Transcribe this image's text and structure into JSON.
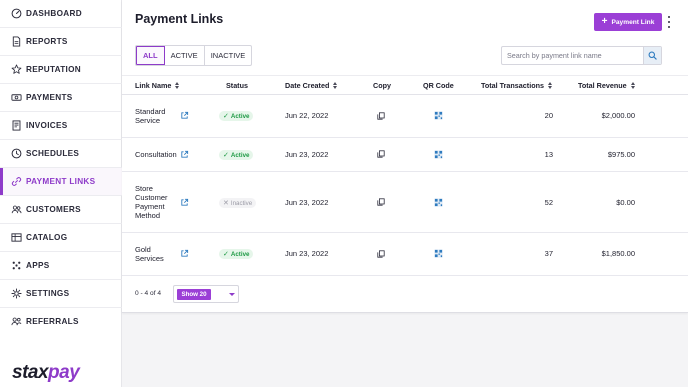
{
  "sidebar": {
    "items": [
      {
        "label": "DASHBOARD",
        "icon": "dashboard-gauge-icon"
      },
      {
        "label": "REPORTS",
        "icon": "document-icon"
      },
      {
        "label": "REPUTATION",
        "icon": "star-icon"
      },
      {
        "label": "PAYMENTS",
        "icon": "money-icon"
      },
      {
        "label": "INVOICES",
        "icon": "invoice-icon"
      },
      {
        "label": "SCHEDULES",
        "icon": "clock-icon"
      },
      {
        "label": "PAYMENT LINKS",
        "icon": "link-icon",
        "active": true
      },
      {
        "label": "CUSTOMERS",
        "icon": "users-icon"
      },
      {
        "label": "CATALOG",
        "icon": "catalog-icon"
      },
      {
        "label": "APPS",
        "icon": "apps-icon"
      },
      {
        "label": "SETTINGS",
        "icon": "gear-icon"
      },
      {
        "label": "REFERRALS",
        "icon": "referrals-icon"
      }
    ],
    "logo": {
      "part1": "stax",
      "part2": "pay"
    }
  },
  "header": {
    "title": "Payment Links",
    "primary_button": "Payment Link"
  },
  "filters": {
    "options": [
      "ALL",
      "ACTIVE",
      "INACTIVE"
    ],
    "selected": "ALL"
  },
  "search": {
    "placeholder": "Search by payment link name",
    "value": ""
  },
  "table": {
    "columns": {
      "name": "Link Name",
      "status": "Status",
      "date": "Date Created",
      "copy": "Copy",
      "qr": "QR Code",
      "transactions": "Total Transactions",
      "revenue": "Total Revenue"
    },
    "rows": [
      {
        "name": "Standard Service",
        "status": "Active",
        "date": "Jun 22, 2022",
        "transactions": "20",
        "revenue": "$2,000.00"
      },
      {
        "name": "Consultation",
        "status": "Active",
        "date": "Jun 23, 2022",
        "transactions": "13",
        "revenue": "$975.00"
      },
      {
        "name": "Store Customer Payment Method",
        "status": "Inactive",
        "date": "Jun 23, 2022",
        "transactions": "52",
        "revenue": "$0.00"
      },
      {
        "name": "Gold Services",
        "status": "Active",
        "date": "Jun 23, 2022",
        "transactions": "37",
        "revenue": "$1,850.00"
      }
    ]
  },
  "pagination": {
    "range": "0 - 4 of 4",
    "page_size_label": "Show 20"
  },
  "colors": {
    "accent": "#9b3fd6",
    "active_status": "#1f9a45",
    "inactive_status": "#9b9ba6"
  }
}
